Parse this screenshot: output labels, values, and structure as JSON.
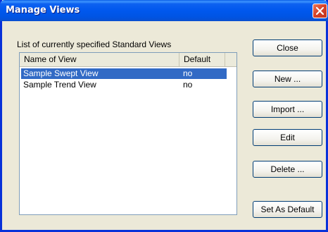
{
  "window": {
    "title": "Manage Views"
  },
  "group": {
    "label": "List of currently specified Standard Views"
  },
  "list": {
    "columns": [
      "Name of View",
      "Default"
    ],
    "rows": [
      {
        "name": "Sample Swept View",
        "default": "no",
        "selected": true
      },
      {
        "name": "Sample Trend View",
        "default": "no",
        "selected": false
      }
    ]
  },
  "buttons": {
    "close": "Close",
    "new": "New ...",
    "import": "Import ...",
    "edit": "Edit",
    "delete": "Delete ...",
    "set_default": "Set As Default"
  },
  "colors": {
    "titlebar": "#0054e3",
    "selection": "#316ac5",
    "close_button": "#d8432a"
  }
}
